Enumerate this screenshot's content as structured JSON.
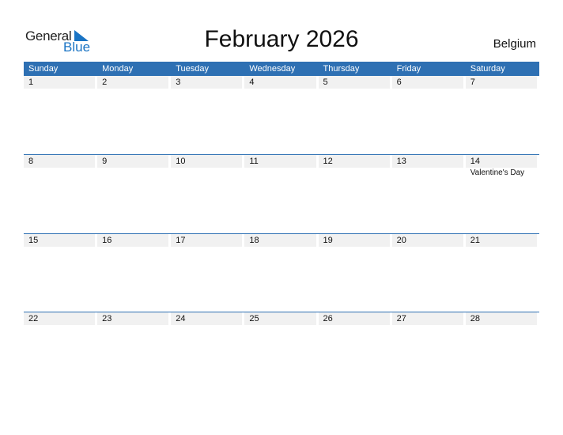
{
  "logo": {
    "general": "General",
    "blue": "Blue"
  },
  "title": "February 2026",
  "country": "Belgium",
  "weekdays": [
    "Sunday",
    "Monday",
    "Tuesday",
    "Wednesday",
    "Thursday",
    "Friday",
    "Saturday"
  ],
  "weeks": [
    {
      "days": [
        {
          "num": "1",
          "event": ""
        },
        {
          "num": "2",
          "event": ""
        },
        {
          "num": "3",
          "event": ""
        },
        {
          "num": "4",
          "event": ""
        },
        {
          "num": "5",
          "event": ""
        },
        {
          "num": "6",
          "event": ""
        },
        {
          "num": "7",
          "event": ""
        }
      ]
    },
    {
      "days": [
        {
          "num": "8",
          "event": ""
        },
        {
          "num": "9",
          "event": ""
        },
        {
          "num": "10",
          "event": ""
        },
        {
          "num": "11",
          "event": ""
        },
        {
          "num": "12",
          "event": ""
        },
        {
          "num": "13",
          "event": ""
        },
        {
          "num": "14",
          "event": "Valentine's Day"
        }
      ]
    },
    {
      "days": [
        {
          "num": "15",
          "event": ""
        },
        {
          "num": "16",
          "event": ""
        },
        {
          "num": "17",
          "event": ""
        },
        {
          "num": "18",
          "event": ""
        },
        {
          "num": "19",
          "event": ""
        },
        {
          "num": "20",
          "event": ""
        },
        {
          "num": "21",
          "event": ""
        }
      ]
    },
    {
      "days": [
        {
          "num": "22",
          "event": ""
        },
        {
          "num": "23",
          "event": ""
        },
        {
          "num": "24",
          "event": ""
        },
        {
          "num": "25",
          "event": ""
        },
        {
          "num": "26",
          "event": ""
        },
        {
          "num": "27",
          "event": ""
        },
        {
          "num": "28",
          "event": ""
        }
      ]
    }
  ],
  "colors": {
    "accent": "#2e70b3",
    "logo_blue": "#1a74c4",
    "date_bar": "#f1f1f1"
  }
}
